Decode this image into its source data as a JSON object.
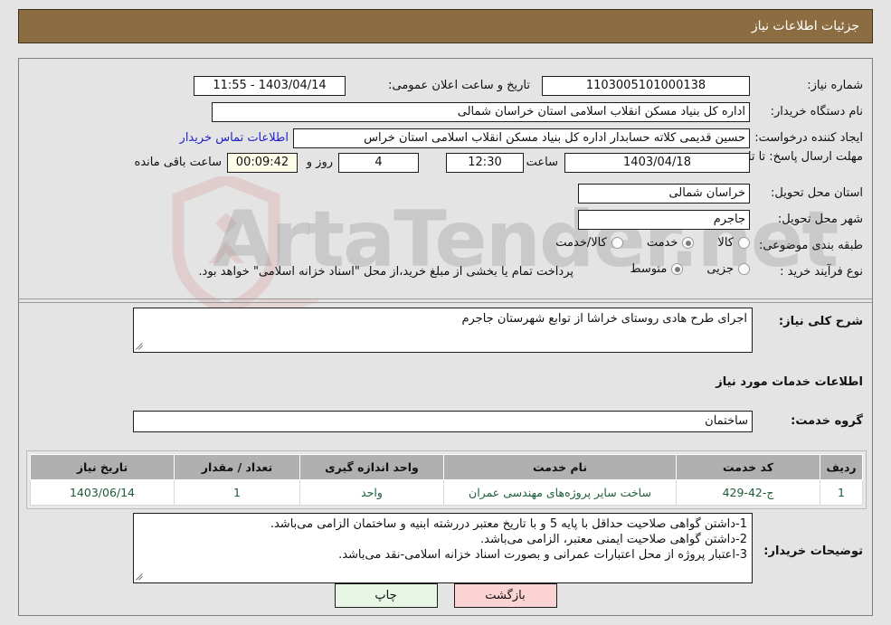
{
  "header": {
    "title": "جزئیات اطلاعات نیاز"
  },
  "form": {
    "need_number_label": "شماره نیاز:",
    "need_number_value": "1103005101000138",
    "announce_label": "تاریخ و ساعت اعلان عمومی:",
    "announce_value": "1403/04/14 - 11:55",
    "buyer_org_label": "نام دستگاه خریدار:",
    "buyer_org_value": "اداره کل بنیاد مسکن انقلاب اسلامی استان خراسان شمالی",
    "creator_label": "ایجاد کننده درخواست:",
    "creator_value": "حسین قدیمی کلاته حسابدار اداره کل بنیاد مسکن انقلاب اسلامی استان خراس",
    "contact_link": "اطلاعات تماس خریدار",
    "deadline_label": "مهلت ارسال پاسخ: تا تاریخ:",
    "deadline_date": "1403/04/18",
    "hour_label": "ساعت",
    "deadline_time": "12:30",
    "days_value": "4",
    "days_label": "روز و",
    "countdown_value": "00:09:42",
    "countdown_label": "ساعت باقی مانده",
    "province_label": "استان محل تحویل:",
    "province_value": "خراسان شمالی",
    "city_label": "شهر محل تحویل:",
    "city_value": "جاجرم",
    "category_label": "طبقه بندی موضوعی:",
    "category_options": [
      {
        "label": "کالا",
        "selected": false
      },
      {
        "label": "خدمت",
        "selected": true
      },
      {
        "label": "کالا/خدمت",
        "selected": false
      }
    ],
    "process_label": "نوع فرآیند خرید :",
    "process_options": [
      {
        "label": "جزیی",
        "selected": false
      },
      {
        "label": "متوسط",
        "selected": true
      }
    ],
    "payment_note": "پرداخت تمام یا بخشی از مبلغ خرید،از محل \"اسناد خزانه اسلامی\" خواهد بود."
  },
  "description": {
    "label": "شرح کلی نیاز:",
    "value": "اجرای طرح هادی روستای خراشا از توابع شهرستان جاجرم"
  },
  "services_section": {
    "title": "اطلاعات خدمات مورد نیاز",
    "group_label": "گروه خدمت:",
    "group_value": "ساختمان"
  },
  "table": {
    "columns": [
      "ردیف",
      "کد خدمت",
      "نام خدمت",
      "واحد اندازه گیری",
      "تعداد / مقدار",
      "تاریخ نیاز"
    ],
    "rows": [
      {
        "row": "1",
        "code": "ج-42-429",
        "name": "ساخت سایر پروژه‌های مهندسی عمران",
        "unit": "واحد",
        "qty": "1",
        "date": "1403/06/14"
      }
    ]
  },
  "buyer_notes": {
    "label": "توضیحات خریدار:",
    "lines": [
      "1-داشتن گواهی صلاحیت حداقل با پایه 5 و با تاریخ معتبر دررشته ابنیه و ساختمان الزامی می‌باشد.",
      "2-داشتن گواهی صلاحیت ایمنی معتبر، الزامی می‌باشد.",
      "3-اعتبار پروژه از محل اعتبارات عمرانی و بصورت اسناد خزانه اسلامی-نقد می‌باشد."
    ]
  },
  "buttons": {
    "print": "چاپ",
    "back": "بازگشت"
  },
  "watermark": {
    "text_left": "Arta",
    "text_right": "Tender",
    "suffix": ".net"
  },
  "colors": {
    "header_bar": "#8c6c41",
    "page_bg": "#e4e4e4",
    "link": "#2222cc",
    "table_header": "#b0b0b0",
    "table_text": "#1d5c3a",
    "print_btn": "#e8f6e6",
    "back_btn": "#fbd3d3"
  }
}
